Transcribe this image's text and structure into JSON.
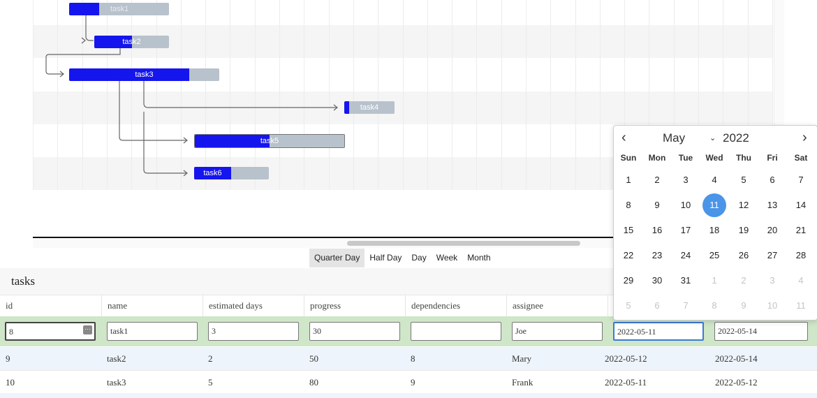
{
  "gantt": {
    "tasks": [
      {
        "name": "task1",
        "progress": 30
      },
      {
        "name": "task2",
        "progress": 50
      },
      {
        "name": "task3",
        "progress": 80
      },
      {
        "name": "task4",
        "progress": 10
      },
      {
        "name": "task5",
        "progress": 50
      },
      {
        "name": "task6",
        "progress": 60
      }
    ]
  },
  "view_modes": [
    "Quarter Day",
    "Half Day",
    "Day",
    "Week",
    "Month"
  ],
  "active_view_mode": "Quarter Day",
  "table": {
    "title": "tasks",
    "headers": [
      "id",
      "name",
      "estimated days",
      "progress",
      "dependencies",
      "assignee",
      "",
      ""
    ],
    "edit_row": {
      "id": "8",
      "name": "task1",
      "estimated_days": "3",
      "progress": "30",
      "dependencies": "",
      "assignee": "Joe",
      "start": "2022-05-11",
      "end": "2022-05-14"
    },
    "rows": [
      [
        "9",
        "task2",
        "2",
        "50",
        "8",
        "Mary",
        "2022-05-12",
        "2022-05-14"
      ],
      [
        "10",
        "task3",
        "5",
        "80",
        "9",
        "Frank",
        "2022-05-11",
        "2022-05-12"
      ]
    ]
  },
  "datepicker": {
    "month": "May",
    "year": "2022",
    "prev": "‹",
    "next": "›",
    "weekdays": [
      "Sun",
      "Mon",
      "Tue",
      "Wed",
      "Thu",
      "Fri",
      "Sat"
    ],
    "weeks": [
      [
        "1",
        "2",
        "3",
        "4",
        "5",
        "6",
        "7"
      ],
      [
        "8",
        "9",
        "10",
        "11",
        "12",
        "13",
        "14"
      ],
      [
        "15",
        "16",
        "17",
        "18",
        "19",
        "20",
        "21"
      ],
      [
        "22",
        "23",
        "24",
        "25",
        "26",
        "27",
        "28"
      ],
      [
        "29",
        "30",
        "31",
        "1",
        "2",
        "3",
        "4"
      ],
      [
        "5",
        "6",
        "7",
        "8",
        "9",
        "10",
        "11"
      ]
    ],
    "selected": "11"
  },
  "colors": {
    "progress": "#1515ee",
    "bar": "#b8c2cc",
    "edit_row": "#cfe6c8",
    "alt_row": "#eef4fb",
    "selected_day": "#4a95e8"
  }
}
